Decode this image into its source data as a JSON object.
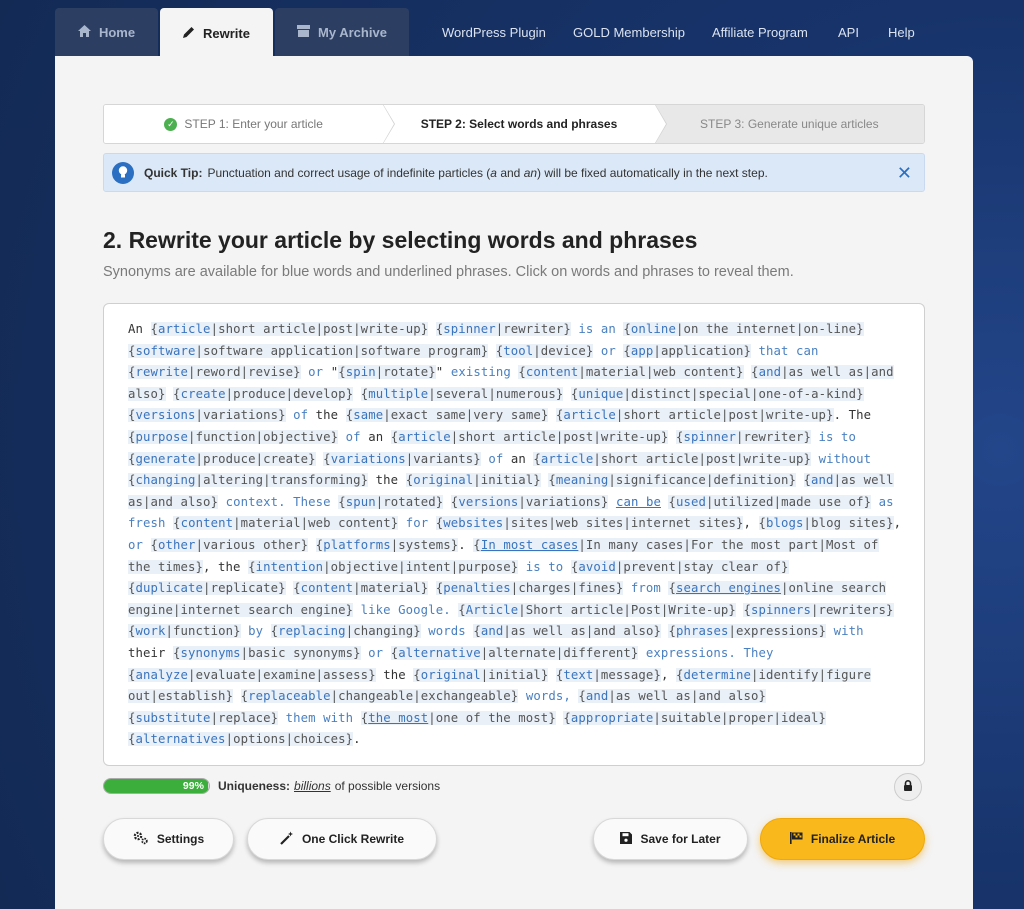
{
  "nav": {
    "tabs": [
      {
        "label": "Home",
        "icon": "home-icon"
      },
      {
        "label": "Rewrite",
        "icon": "pencil-icon"
      },
      {
        "label": "My Archive",
        "icon": "archive-icon"
      }
    ],
    "links": [
      "WordPress Plugin",
      "GOLD Membership",
      "Affiliate Program",
      "API",
      "Help"
    ]
  },
  "steps": [
    {
      "label": "STEP 1: Enter your article",
      "done": true
    },
    {
      "label": "STEP 2: Select words and phrases",
      "active": true
    },
    {
      "label": "STEP 3: Generate unique articles"
    }
  ],
  "tip": {
    "title": "Quick Tip:",
    "text_before": "Punctuation and correct usage of indefinite particles (",
    "a": "a",
    "and": " and ",
    "an": "an",
    "text_after": ") will be fixed automatically in the next step."
  },
  "heading": "2. Rewrite your article by selecting words and phrases",
  "subheading": "Synonyms are available for blue words and underlined phrases. Click on words and phrases to reveal them.",
  "article": [
    {
      "t": "An "
    },
    {
      "s": [
        "article",
        "short article",
        "post",
        "write-up"
      ]
    },
    {
      "t": " "
    },
    {
      "s": [
        "spinner",
        "rewriter"
      ]
    },
    {
      "t": " "
    },
    {
      "w": "is an"
    },
    {
      "t": " "
    },
    {
      "s": [
        "online",
        "on the internet",
        "on-line"
      ]
    },
    {
      "t": " "
    },
    {
      "s": [
        "software",
        "software application",
        "software program"
      ]
    },
    {
      "t": " "
    },
    {
      "s": [
        "tool",
        "device"
      ]
    },
    {
      "t": " "
    },
    {
      "w": "or"
    },
    {
      "t": " "
    },
    {
      "s": [
        "app",
        "application"
      ]
    },
    {
      "t": " "
    },
    {
      "w": "that can"
    },
    {
      "t": " "
    },
    {
      "s": [
        "rewrite",
        "reword",
        "revise"
      ]
    },
    {
      "t": " "
    },
    {
      "w": "or"
    },
    {
      "t": " \""
    },
    {
      "s": [
        "spin",
        "rotate"
      ]
    },
    {
      "t": "\" "
    },
    {
      "w": "existing"
    },
    {
      "t": " "
    },
    {
      "s": [
        "content",
        "material",
        "web content"
      ]
    },
    {
      "t": " "
    },
    {
      "s": [
        "and",
        "as well as",
        "and also"
      ]
    },
    {
      "t": " "
    },
    {
      "s": [
        "create",
        "produce",
        "develop"
      ]
    },
    {
      "t": " "
    },
    {
      "s": [
        "multiple",
        "several",
        "numerous"
      ]
    },
    {
      "t": " "
    },
    {
      "s": [
        "unique",
        "distinct",
        "special",
        "one-of-a-kind"
      ]
    },
    {
      "t": " "
    },
    {
      "s": [
        "versions",
        "variations"
      ]
    },
    {
      "t": " "
    },
    {
      "w": "of"
    },
    {
      "t": " the "
    },
    {
      "s": [
        "same",
        "exact same",
        "very same"
      ]
    },
    {
      "t": " "
    },
    {
      "s": [
        "article",
        "short article",
        "post",
        "write-up"
      ]
    },
    {
      "t": ". The "
    },
    {
      "s": [
        "purpose",
        "function",
        "objective"
      ]
    },
    {
      "t": " "
    },
    {
      "w": "of"
    },
    {
      "t": " an "
    },
    {
      "s": [
        "article",
        "short article",
        "post",
        "write-up"
      ]
    },
    {
      "t": " "
    },
    {
      "s": [
        "spinner",
        "rewriter"
      ]
    },
    {
      "t": " "
    },
    {
      "w": "is to"
    },
    {
      "t": " "
    },
    {
      "s": [
        "generate",
        "produce",
        "create"
      ]
    },
    {
      "t": " "
    },
    {
      "s": [
        "variations",
        "variants"
      ]
    },
    {
      "t": " "
    },
    {
      "w": "of"
    },
    {
      "t": " an "
    },
    {
      "s": [
        "article",
        "short article",
        "post",
        "write-up"
      ]
    },
    {
      "t": " "
    },
    {
      "w": "without"
    },
    {
      "t": " "
    },
    {
      "s": [
        "changing",
        "altering",
        "transforming"
      ]
    },
    {
      "t": " the "
    },
    {
      "s": [
        "original",
        "initial"
      ]
    },
    {
      "t": " "
    },
    {
      "s": [
        "meaning",
        "significance",
        "definition"
      ]
    },
    {
      "t": " "
    },
    {
      "s": [
        "and",
        "as well as",
        "and also"
      ]
    },
    {
      "t": " "
    },
    {
      "w": "context."
    },
    {
      "t": " "
    },
    {
      "w": "These"
    },
    {
      "t": " "
    },
    {
      "s": [
        "spun",
        "rotated"
      ]
    },
    {
      "t": " "
    },
    {
      "s": [
        "versions",
        "variations"
      ]
    },
    {
      "t": " "
    },
    {
      "u": "can be"
    },
    {
      "t": " "
    },
    {
      "s": [
        "used",
        "utilized",
        "made use of"
      ]
    },
    {
      "t": " "
    },
    {
      "w": "as fresh"
    },
    {
      "t": " "
    },
    {
      "s": [
        "content",
        "material",
        "web content"
      ]
    },
    {
      "t": " "
    },
    {
      "w": "for"
    },
    {
      "t": " "
    },
    {
      "s": [
        "websites",
        "sites",
        "web sites",
        "internet sites"
      ]
    },
    {
      "t": ", "
    },
    {
      "s": [
        "blogs",
        "blog sites"
      ]
    },
    {
      "t": ", "
    },
    {
      "w": "or"
    },
    {
      "t": " "
    },
    {
      "s": [
        "other",
        "various other"
      ]
    },
    {
      "t": " "
    },
    {
      "s": [
        "platforms",
        "systems"
      ]
    },
    {
      "t": ". "
    },
    {
      "su": [
        "In most cases",
        "In many cases",
        "For the most part",
        "Most of the times"
      ]
    },
    {
      "t": ", the "
    },
    {
      "s": [
        "intention",
        "objective",
        "intent",
        "purpose"
      ]
    },
    {
      "t": " "
    },
    {
      "w": "is to"
    },
    {
      "t": " "
    },
    {
      "s": [
        "avoid",
        "prevent",
        "stay clear of"
      ]
    },
    {
      "t": " "
    },
    {
      "s": [
        "duplicate",
        "replicate"
      ]
    },
    {
      "t": " "
    },
    {
      "s": [
        "content",
        "material"
      ]
    },
    {
      "t": " "
    },
    {
      "s": [
        "penalties",
        "charges",
        "fines"
      ]
    },
    {
      "t": " "
    },
    {
      "w": "from"
    },
    {
      "t": " "
    },
    {
      "su": [
        "search engines",
        "online search engine",
        "internet search engine"
      ]
    },
    {
      "t": " "
    },
    {
      "w": "like Google."
    },
    {
      "t": " "
    },
    {
      "s": [
        "Article",
        "Short article",
        "Post",
        "Write-up"
      ]
    },
    {
      "t": " "
    },
    {
      "s": [
        "spinners",
        "rewriters"
      ]
    },
    {
      "t": " "
    },
    {
      "s": [
        "work",
        "function"
      ]
    },
    {
      "t": " "
    },
    {
      "w": "by"
    },
    {
      "t": " "
    },
    {
      "s": [
        "replacing",
        "changing"
      ]
    },
    {
      "t": " "
    },
    {
      "w": "words"
    },
    {
      "t": " "
    },
    {
      "s": [
        "and",
        "as well as",
        "and also"
      ]
    },
    {
      "t": " "
    },
    {
      "s": [
        "phrases",
        "expressions"
      ]
    },
    {
      "t": " "
    },
    {
      "w": "with"
    },
    {
      "t": " their "
    },
    {
      "s": [
        "synonyms",
        "basic synonyms"
      ]
    },
    {
      "t": " "
    },
    {
      "w": "or"
    },
    {
      "t": " "
    },
    {
      "s": [
        "alternative",
        "alternate",
        "different"
      ]
    },
    {
      "t": " "
    },
    {
      "w": "expressions."
    },
    {
      "t": " "
    },
    {
      "w": "They"
    },
    {
      "t": " "
    },
    {
      "s": [
        "analyze",
        "evaluate",
        "examine",
        "assess"
      ]
    },
    {
      "t": " the "
    },
    {
      "s": [
        "original",
        "initial"
      ]
    },
    {
      "t": " "
    },
    {
      "s": [
        "text",
        "message"
      ]
    },
    {
      "t": ", "
    },
    {
      "s": [
        "determine",
        "identify",
        "figure out",
        "establish"
      ]
    },
    {
      "t": " "
    },
    {
      "s": [
        "replaceable",
        "changeable",
        "exchangeable"
      ]
    },
    {
      "t": " "
    },
    {
      "w": "words,"
    },
    {
      "t": " "
    },
    {
      "s": [
        "and",
        "as well as",
        "and also"
      ]
    },
    {
      "t": " "
    },
    {
      "s": [
        "substitute",
        "replace"
      ]
    },
    {
      "t": " "
    },
    {
      "w": "them with"
    },
    {
      "t": " "
    },
    {
      "su": [
        "the most",
        "one of the most"
      ]
    },
    {
      "t": " "
    },
    {
      "s": [
        "appropriate",
        "suitable",
        "proper",
        "ideal"
      ]
    },
    {
      "t": " "
    },
    {
      "s": [
        "alternatives",
        "options",
        "choices"
      ]
    },
    {
      "t": "."
    }
  ],
  "uniqueness": {
    "percent": 99,
    "percent_label": "99%",
    "label": "Uniqueness:",
    "emph": "billions",
    "suffix": "of possible versions"
  },
  "buttons": {
    "settings": "Settings",
    "one_click": "One Click Rewrite",
    "save": "Save for Later",
    "finalize": "Finalize Article"
  },
  "colors": {
    "accent": "#3a74bd",
    "gold": "#f9b81b",
    "progress": "#3cae3c"
  }
}
